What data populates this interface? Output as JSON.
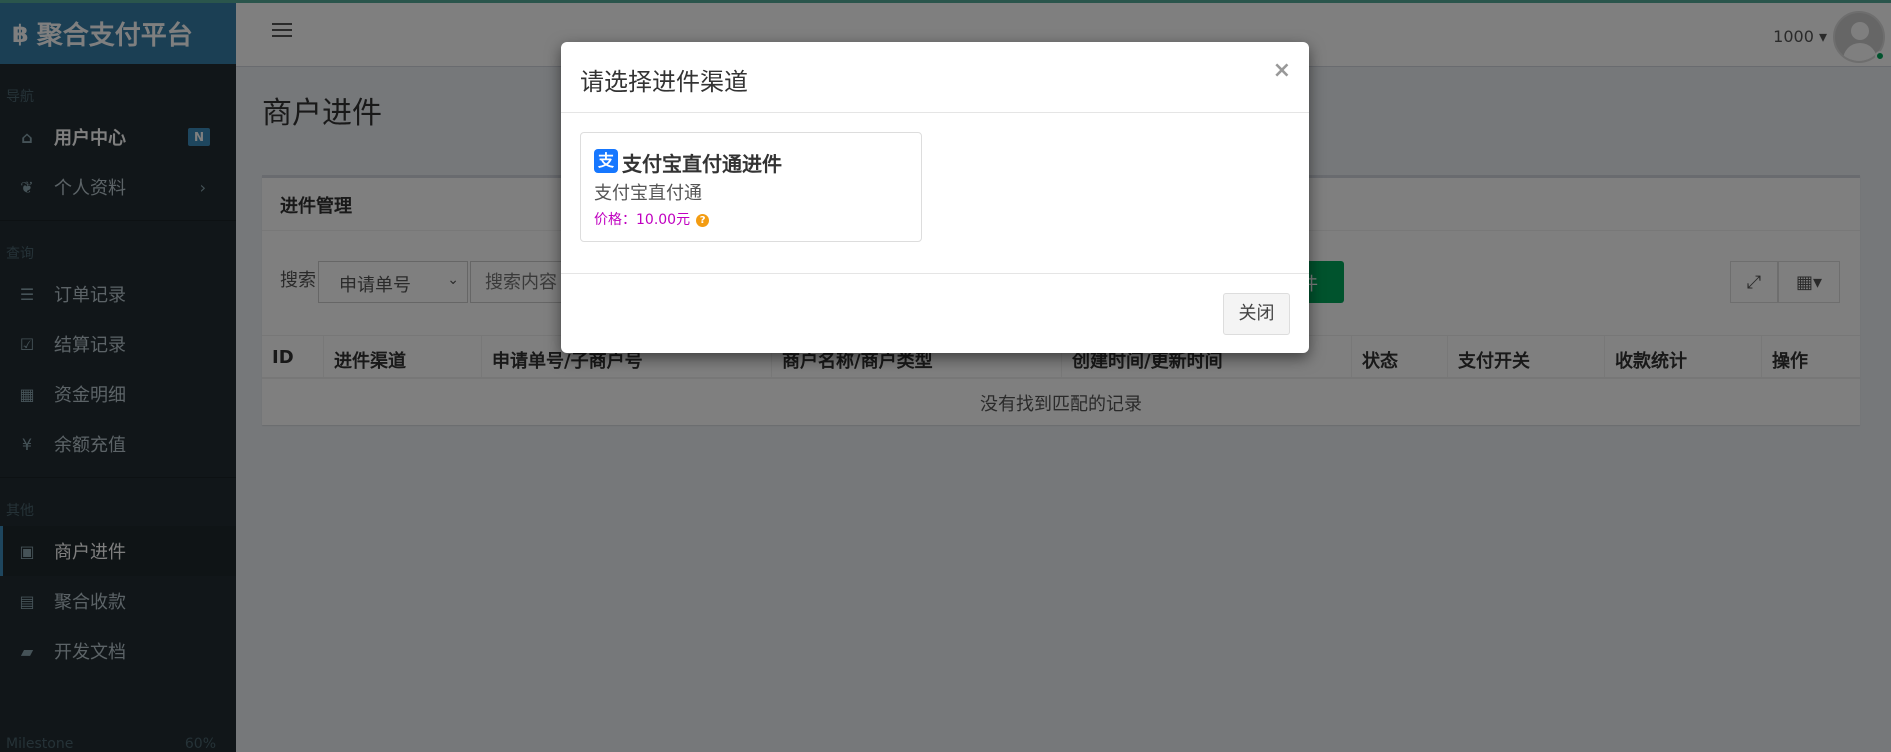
{
  "brand": {
    "logo_icon": "bitcoin-icon",
    "title": "聚合支付平台"
  },
  "sidebar": {
    "sections": [
      {
        "header": "导航"
      },
      {
        "header": "查询"
      },
      {
        "header": "其他"
      }
    ],
    "items": [
      {
        "label": "用户中心",
        "icon": "home-icon",
        "badge": "N"
      },
      {
        "label": "个人资料",
        "icon": "leaf-icon"
      },
      {
        "label": "订单记录",
        "icon": "list-icon"
      },
      {
        "label": "结算记录",
        "icon": "check-square-icon"
      },
      {
        "label": "资金明细",
        "icon": "calendar-icon"
      },
      {
        "label": "余额充值",
        "icon": "yen-icon"
      },
      {
        "label": "商户进件",
        "icon": "id-badge-icon"
      },
      {
        "label": "聚合收款",
        "icon": "barcode-icon"
      },
      {
        "label": "开发文档",
        "icon": "book-icon"
      }
    ],
    "footer_label": "Milestone",
    "footer_value": "60%"
  },
  "header": {
    "user": "1000"
  },
  "page": {
    "title": "商户进件",
    "box_title": "进件管理",
    "search_label": "搜索",
    "search_select": "申请单号",
    "search_placeholder": "搜索内容",
    "green_button": "件",
    "table_headers": [
      "ID",
      "进件渠道",
      "申请单号/子商户号",
      "商户名称/商户类型",
      "创建时间/更新时间",
      "状态",
      "支付开关",
      "收款统计",
      "操作"
    ],
    "empty_text": "没有找到匹配的记录"
  },
  "modal": {
    "title": "请选择进件渠道",
    "close_symbol": "×",
    "card": {
      "title": "支付宝直付通进件",
      "subtitle": "支付宝直付通",
      "price": "价格：10.00元"
    },
    "close_button": "关闭"
  }
}
